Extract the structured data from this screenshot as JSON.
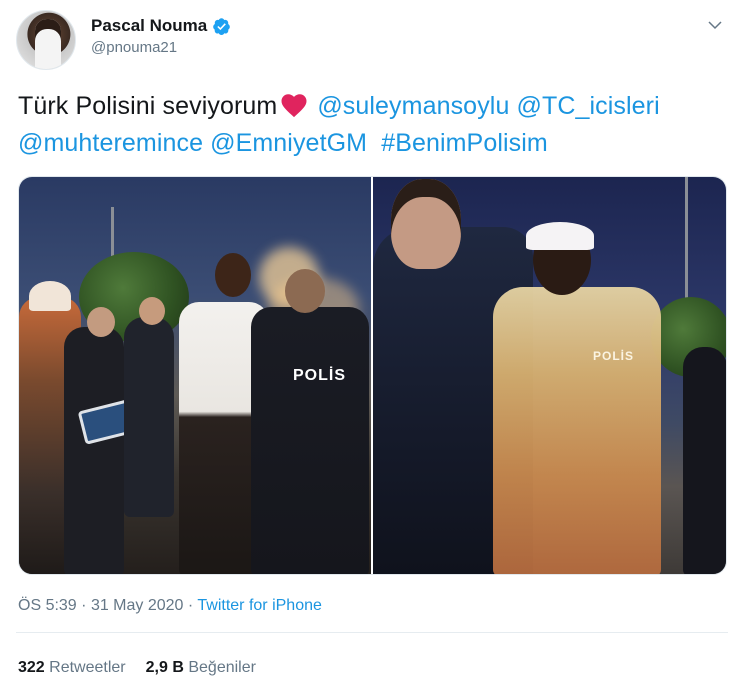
{
  "author": {
    "display_name": "Pascal Nouma",
    "handle": "@pnouma21",
    "verified": true
  },
  "tweet": {
    "text_prefix": "Türk Polisini seviyorum",
    "emoji": "heart-icon",
    "mentions": [
      "@suleymansoylu",
      "@TC_icisleri",
      "@muhteremince",
      "@EmniyetGM"
    ],
    "hashtag": "#BenimPolisim"
  },
  "media": {
    "left_badge": "POLİS",
    "right_badge": "POLİS"
  },
  "meta": {
    "time": "ÖS 5:39",
    "date": "31 May 2020",
    "separator": "·",
    "source": "Twitter for iPhone"
  },
  "stats": {
    "retweets_count": "322",
    "retweets_label": "Retweetler",
    "likes_count": "2,9 B",
    "likes_label": "Beğeniler"
  },
  "colors": {
    "link": "#1b95e0",
    "verified": "#1da1f2",
    "heart": "#e0245e",
    "secondary_text": "#657786"
  }
}
